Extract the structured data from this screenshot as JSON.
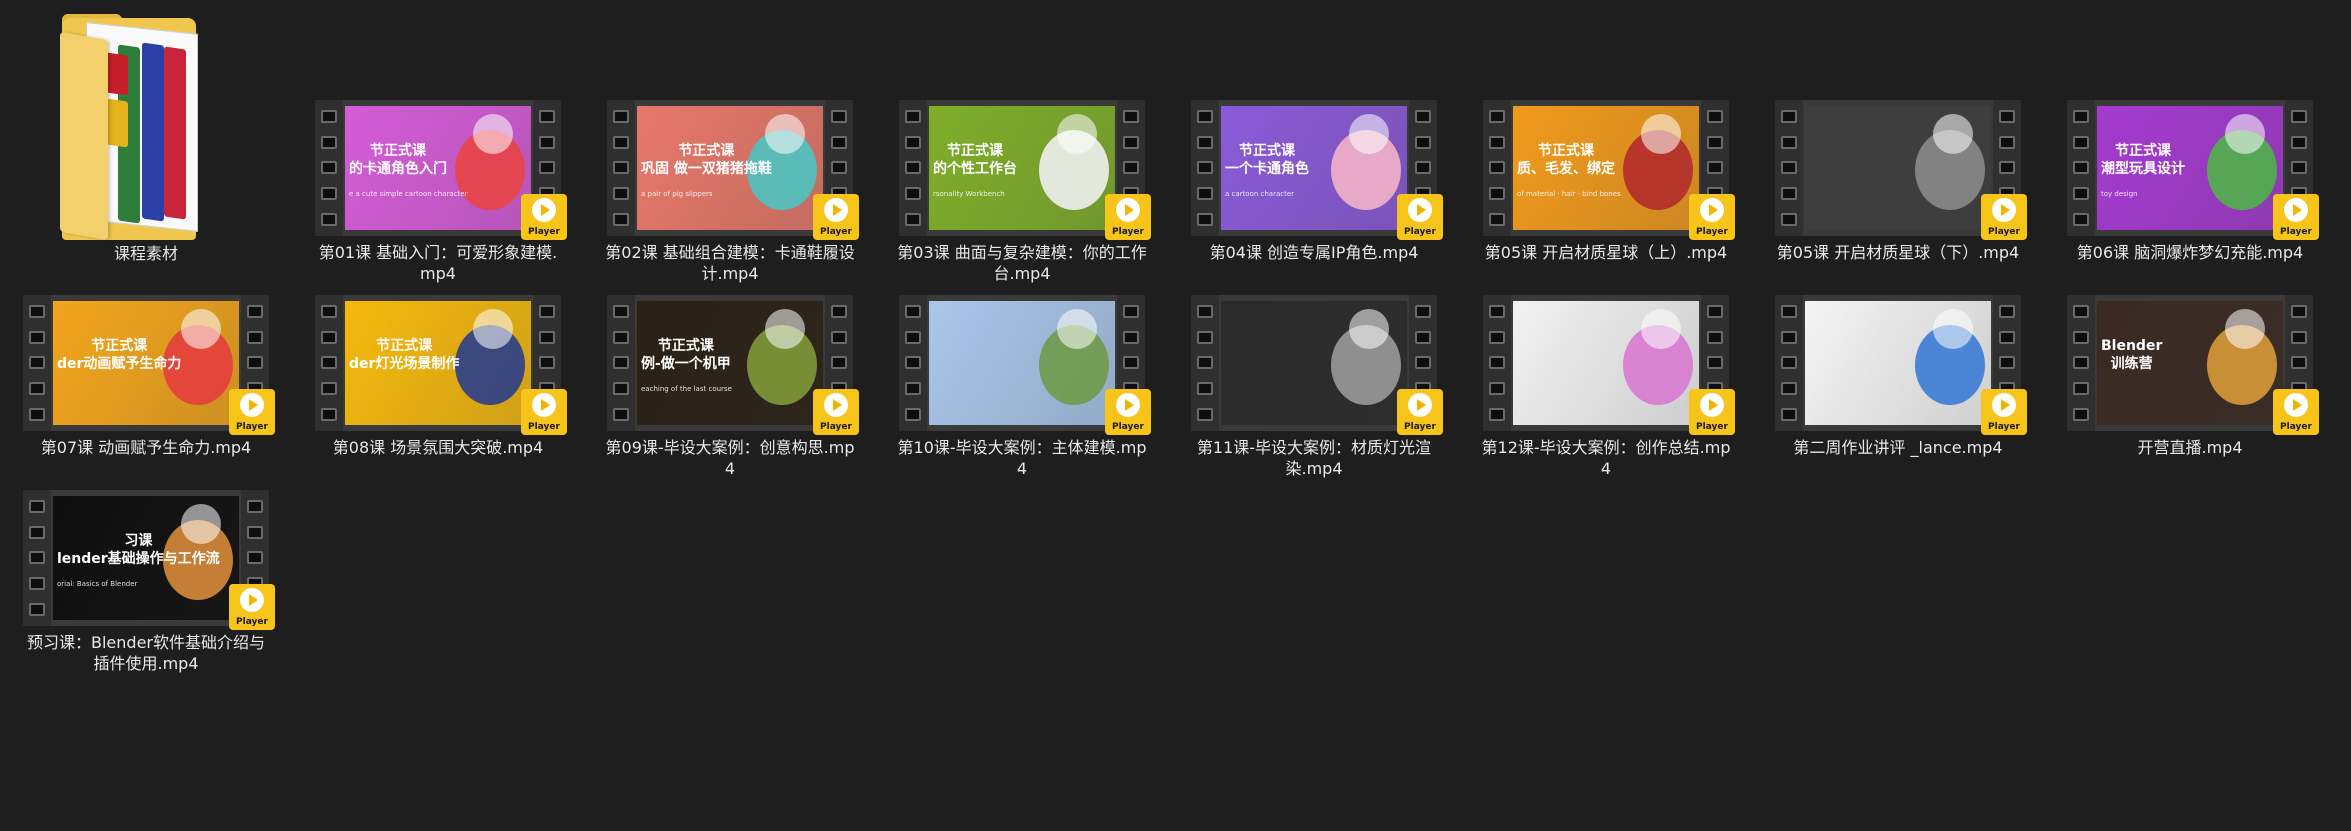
{
  "folder": {
    "name": "课程素材",
    "icon": "folder-icon"
  },
  "badge_label": "Player",
  "videos": [
    {
      "name": "第01课 基础入门：可爱形象建模.mp4",
      "title1": "节正式课",
      "title2": "的卡通角色入门",
      "sub": "e a cute simple cartoon character",
      "bg": "#d55cd8",
      "accent": "#e84545"
    },
    {
      "name": "第02课 基础组合建模：卡通鞋履设计.mp4",
      "title1": "节正式课",
      "title2": "巩固 做一双猪猪拖鞋",
      "sub": "a pair of pig slippers",
      "bg": "#e7786a",
      "accent": "#4ec3c1"
    },
    {
      "name": "第03课 曲面与复杂建模：你的工作台.mp4",
      "title1": "节正式课",
      "title2": "的个性工作台",
      "sub": "rsonality Workbench",
      "bg": "#7fae2a",
      "accent": "#f0f0f0"
    },
    {
      "name": "第04课 创造专属IP角色.mp4",
      "title1": "节正式课",
      "title2": "一个卡通角色",
      "sub": "a cartoon character",
      "bg": "#8a5ad8",
      "accent": "#f3b3c8"
    },
    {
      "name": "第05课 开启材质星球（上）.mp4",
      "title1": "节正式课",
      "title2": "质、毛发、绑定",
      "sub": "of material · hair · bind bones",
      "bg": "#f19a1c",
      "accent": "#b32b2b"
    },
    {
      "name": "第05课 开启材质星球（下）.mp4",
      "title1": "",
      "title2": "",
      "sub": "",
      "bg": "#3e3e3e",
      "accent": "#8a8a8a"
    },
    {
      "name": "第06课 脑洞爆炸梦幻充能.mp4",
      "title1": "节正式课",
      "title2": "潮型玩具设计",
      "sub": "toy design",
      "bg": "#a43ad0",
      "accent": "#4fb34a"
    },
    {
      "name": "第07课 动画赋予生命力.mp4",
      "title1": "节正式课",
      "title2": "der动画赋予生命力",
      "sub": "",
      "bg": "#f2a51c",
      "accent": "#e63d3d"
    },
    {
      "name": "第08课 场景氛围大突破.mp4",
      "title1": "节正式课",
      "title2": "der灯光场景制作",
      "sub": "",
      "bg": "#f5b90e",
      "accent": "#2a3e8a"
    },
    {
      "name": "第09课-毕设大案例：创意构思.mp4",
      "title1": "节正式课",
      "title2": "例-做一个机甲",
      "sub": "eaching of the last course",
      "bg": "#2a2115",
      "accent": "#7f9a3a"
    },
    {
      "name": "第10课-毕设大案例：主体建模.mp4",
      "title1": "",
      "title2": "",
      "sub": "",
      "bg": "#a9c6ea",
      "accent": "#6f9a4a"
    },
    {
      "name": "第11课-毕设大案例：材质灯光渲染.mp4",
      "title1": "",
      "title2": "",
      "sub": "",
      "bg": "#2a2a2a",
      "accent": "#9a9a9a"
    },
    {
      "name": "第12课-毕设大案例：创作总结.mp4",
      "title1": "",
      "title2": "",
      "sub": "",
      "bg": "#f2f2f2",
      "accent": "#d77ad0"
    },
    {
      "name": "第二周作业讲评 _lance.mp4",
      "title1": "",
      "title2": "",
      "sub": "",
      "bg": "#f4f4f4",
      "accent": "#3a7bd5"
    },
    {
      "name": "开营直播.mp4",
      "title1": "Blender",
      "title2": "训练营",
      "sub": "",
      "bg": "#3a2a22",
      "accent": "#d89a3a"
    },
    {
      "name": "预习课：Blender软件基础介绍与插件使用.mp4",
      "title1": "习课",
      "title2": "lender基础操作与工作流",
      "sub": "orial: Basics of Blender",
      "bg": "#0e0e0e",
      "accent": "#d88a3a"
    }
  ]
}
